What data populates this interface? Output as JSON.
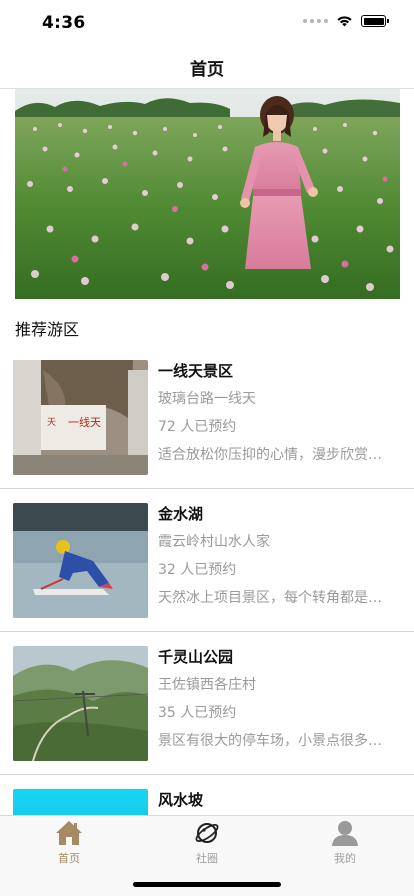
{
  "status_bar": {
    "time": "4:36"
  },
  "nav": {
    "title": "首页"
  },
  "section": {
    "title": "推荐游区"
  },
  "spots": [
    {
      "name": "一线天景区",
      "address": "玻璃台路一线天",
      "booked": "72 人已预约",
      "desc": "适合放松你压抑的心情，漫步欣赏美景"
    },
    {
      "name": "金水湖",
      "address": "霞云岭村山水人家",
      "booked": "32 人已预约",
      "desc": "天然冰上项目景区，每个转角都是风景"
    },
    {
      "name": "千灵山公园",
      "address": "王佐镇西各庄村",
      "booked": "35 人已预约",
      "desc": "景区有很大的停车场，小景点很多值得一游"
    },
    {
      "name": "风水坡",
      "address": "",
      "booked": "",
      "desc": ""
    }
  ],
  "tabs": [
    {
      "label": "首页",
      "icon": "home-icon",
      "active": true
    },
    {
      "label": "社圈",
      "icon": "planet-icon",
      "active": false
    },
    {
      "label": "我的",
      "icon": "user-icon",
      "active": false
    }
  ],
  "colors": {
    "active_tab": "#a68a64",
    "inactive_tab": "#a0a0a0",
    "secondary_text": "#9a9a9a"
  }
}
